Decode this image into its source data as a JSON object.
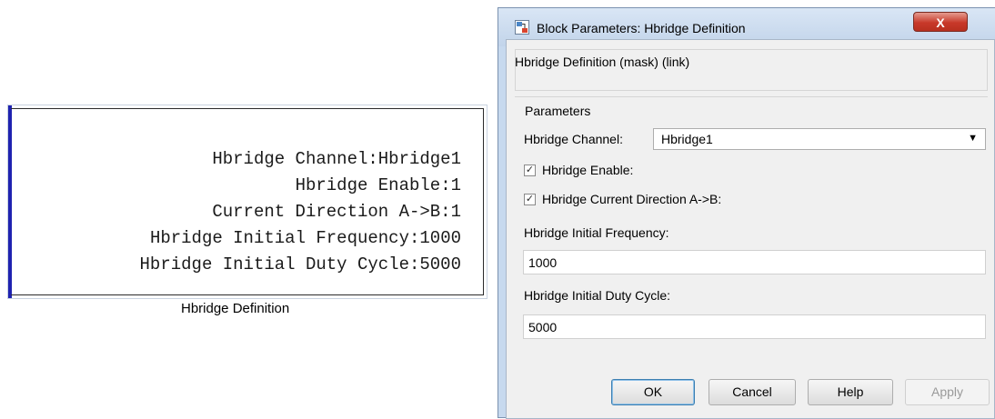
{
  "block": {
    "lines": [
      "Hbridge Channel:Hbridge1",
      "Hbridge Enable:1",
      "Current Direction A->B:1",
      "Hbridge Initial Frequency:1000",
      "Hbridge Initial Duty Cycle:5000"
    ],
    "caption": "Hbridge Definition"
  },
  "dialog": {
    "title": "Block Parameters: Hbridge Definition",
    "close_label": "X",
    "mask_title": "Hbridge Definition (mask) (link)",
    "parameters_label": "Parameters",
    "channel_label": "Hbridge Channel:",
    "channel_value": "Hbridge1",
    "enable_label": "Hbridge Enable:",
    "enable_checked": true,
    "direction_label": "Hbridge Current Direction A->B:",
    "direction_checked": true,
    "frequency_label": "Hbridge Initial Frequency:",
    "frequency_value": "1000",
    "duty_label": "Hbridge Initial Duty Cycle:",
    "duty_value": "5000",
    "buttons": {
      "ok": "OK",
      "cancel": "Cancel",
      "help": "Help",
      "apply": "Apply"
    }
  },
  "icons": {
    "title_icon": "simulink-block-icon",
    "close_icon": "close-icon",
    "dropdown_icon": "chevron-down-icon",
    "checkmark_icon": "checkmark-icon"
  },
  "colors": {
    "block_edge": "#1f22b0",
    "close_button": "#c8392a",
    "titlebar": "#c7d9ee"
  }
}
